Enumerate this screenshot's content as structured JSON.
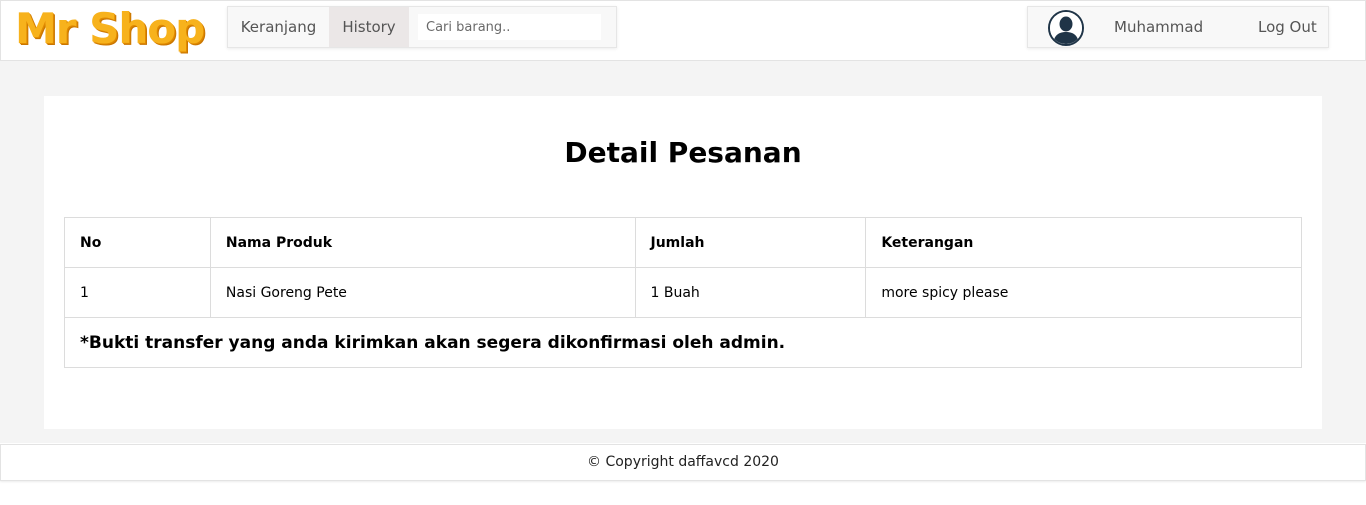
{
  "header": {
    "logo_text": "Mr Shop",
    "nav": {
      "keranjang_label": "Keranjang",
      "history_label": "History"
    },
    "search": {
      "placeholder": "Cari barang..",
      "value": ""
    },
    "user": {
      "name": "Muhammad",
      "logout_label": "Log Out",
      "avatar_icon": "user-silhouette-icon"
    }
  },
  "main": {
    "title": "Detail Pesanan",
    "table": {
      "headers": [
        "No",
        "Nama Produk",
        "Jumlah",
        "Keterangan"
      ],
      "rows": [
        [
          "1",
          "Nasi Goreng Pete",
          "1 Buah",
          "more spicy please"
        ]
      ]
    },
    "note": "*Bukti transfer yang anda kirimkan akan segera dikonfirmasi oleh admin."
  },
  "footer": {
    "copyright": "© Copyright daffavcd 2020"
  },
  "colors": {
    "logo": "#f7b21c",
    "active_nav_bg": "#ebe7e7",
    "page_bg": "#f4f4f4"
  }
}
